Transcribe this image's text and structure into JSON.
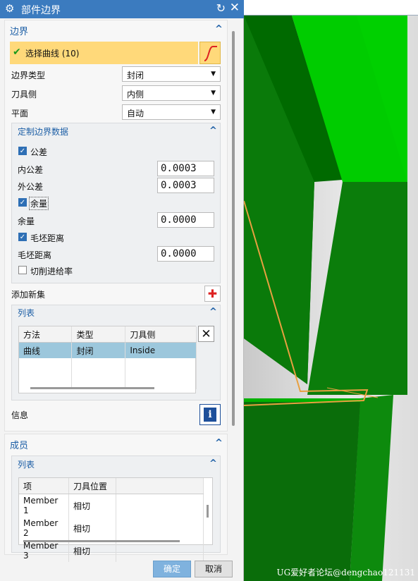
{
  "dialog": {
    "title": "部件边界",
    "boundary": {
      "header": "边界",
      "select_curve_label": "选择曲线 (10)",
      "boundary_type": {
        "label": "边界类型",
        "value": "封闭"
      },
      "tool_side": {
        "label": "刀具侧",
        "value": "内侧"
      },
      "plane": {
        "label": "平面",
        "value": "自动"
      },
      "custom": {
        "header": "定制边界数据",
        "tolerance": {
          "label": "公差",
          "checked": true
        },
        "inner_tol": {
          "label": "内公差",
          "value": "0.0003"
        },
        "outer_tol": {
          "label": "外公差",
          "value": "0.0003"
        },
        "stock_cb": {
          "label": "余量",
          "checked": true
        },
        "stock": {
          "label": "余量",
          "value": "0.0000"
        },
        "blank_cb": {
          "label": "毛坯距离",
          "checked": true
        },
        "blank": {
          "label": "毛坯距离",
          "value": "0.0000"
        },
        "feedrate": {
          "label": "切削进给率",
          "checked": false
        }
      },
      "add_new_set": "添加新集",
      "list": {
        "header": "列表",
        "columns": [
          "方法",
          "类型",
          "刀具侧"
        ],
        "rows": [
          [
            "曲线",
            "封闭",
            "Inside"
          ]
        ]
      },
      "info": "信息"
    },
    "members": {
      "header": "成员",
      "list": {
        "header": "列表",
        "columns": [
          "项",
          "刀具位置"
        ],
        "rows": [
          [
            "Member 1",
            "相切"
          ],
          [
            "Member 2",
            "相切"
          ],
          [
            "Member 3",
            "相切"
          ]
        ]
      }
    },
    "ok": "确定",
    "cancel": "取消"
  },
  "watermark": "UG爱好者论坛@dengchao121131",
  "colors": {
    "title_bar": "#3b7bbf",
    "selection_highlight": "#ffd97a",
    "model_green": "#00cc00",
    "boundary_orange": "#e8a040"
  }
}
